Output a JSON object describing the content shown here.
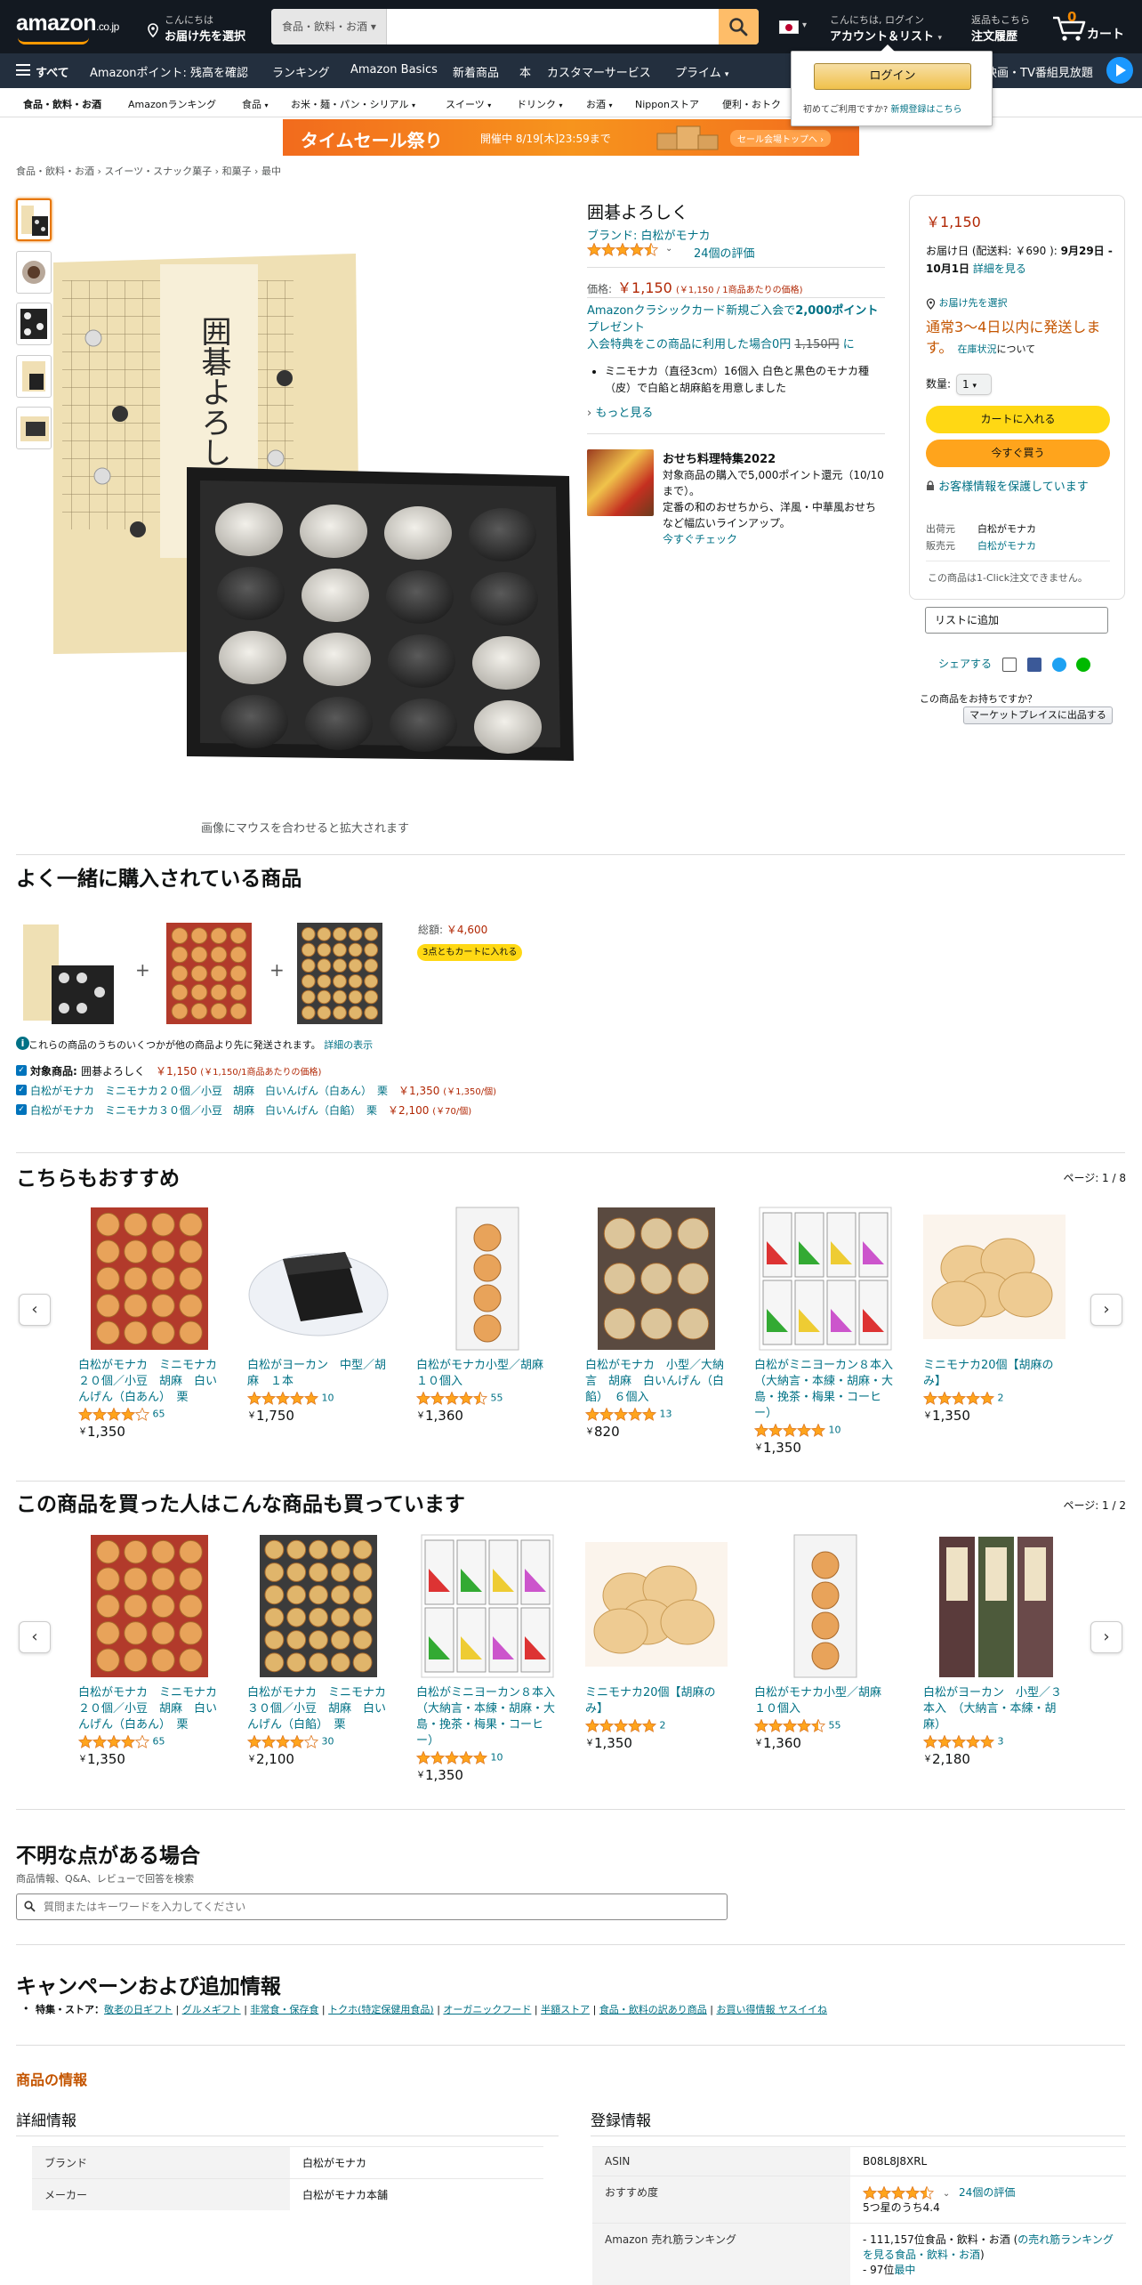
{
  "header": {
    "logo_text": "amazon",
    "logo_tld": ".co.jp",
    "deliver_line1": "こんにちは",
    "deliver_line2": "お届け先を選択",
    "search_category": "食品・飲料・お酒",
    "search_placeholder": "",
    "account_line1": "こんにちは, ログイン",
    "account_line2": "アカウント＆リスト",
    "orders_line1": "返品もこちら",
    "orders_line2": "注文履歴",
    "cart_count": "0",
    "cart_label": "カート"
  },
  "nav_main": {
    "all_label": "すべて",
    "items": [
      "Amazonポイント: 残高を確認",
      "ランキング",
      "Amazon Basics",
      "新着商品",
      "本",
      "カスタマーサービス",
      "プライム"
    ],
    "right_item": "映画・TV番組見放題"
  },
  "subnav": {
    "items": [
      "食品・飲料・お酒",
      "Amazonランキング",
      "食品",
      "お米・麺・パン・シリアル",
      "スイーツ",
      "ドリンク",
      "お酒",
      "Nipponストア",
      "便利・おトク"
    ]
  },
  "signin_flyout": {
    "button": "ログイン",
    "note": "初めてご利用ですか?",
    "note_link": "新規登録はこちら"
  },
  "sale_banner": {
    "title": "タイムセール祭り",
    "subtitle": "開催中 8/19[木]23:59まで",
    "link": "セール会場トップへ ›"
  },
  "breadcrumb": "食品・飲料・お酒 › スイーツ・スナック菓子 › 和菓子 › 最中",
  "product": {
    "box_text": "囲碁よろしく",
    "title": "囲碁よろしく",
    "brand": "ブランド: 白松がモナカ",
    "rating": 4.5,
    "rating_count": "24個の評価",
    "price_label": "価格:",
    "price": "￥1,150",
    "price_unit": "(￥1,150 / 1商品あたりの価格)",
    "card_promo_1": "Amazonクラシックカード新規ご入会で",
    "card_promo_points": "2,000ポイント",
    "card_promo_2": "プレゼント",
    "card_promo_3": "入会特典をこの商品に利用した場合0円",
    "card_promo_strike": "1,150円",
    "card_promo_4": "に",
    "bullet": "ミニモナカ（直径3cm）16個入 白色と黒色のモナカ種（皮）で白餡と胡麻餡を用意しました",
    "more_link": "もっと見る",
    "zoom_hint": "画像にマウスを合わせると拡大されます"
  },
  "osechi": {
    "title": "おせち料理特集2022",
    "line1": "対象商品の購入で5,000ポイント還元（10/10まで）。",
    "line2": "定番の和のおせちから、洋風・中華風おせちなど幅広いラインアップ。",
    "link": "今すぐチェック"
  },
  "buybox": {
    "price": "￥1,150",
    "delivery_1": "お届け日 (配送料: ￥690 ): ",
    "delivery_bold": "9月29日 - 10月1日",
    "delivery_link": "詳細を見る",
    "location": "お届け先を選択",
    "stock": "通常3～4日以内に発送します。",
    "stock_link": "在庫状況",
    "stock_tail": "について",
    "qty_label": "数量:",
    "qty_value": "1",
    "add_to_cart": "カートに入れる",
    "buy_now": "今すぐ買う",
    "secure": "お客様情報を保護しています",
    "ship_from_label": "出荷元",
    "ship_from": "白松がモナカ",
    "sold_by_label": "販売元",
    "sold_by": "白松がモナカ",
    "oneclick": "この商品は1-Click注文できません。",
    "add_to_list": "リストに追加",
    "share": "シェアする",
    "sell_q": "この商品をお持ちですか？",
    "sell_btn": "マーケットプレイスに出品する"
  },
  "fbt": {
    "title": "よく一緒に購入されている商品",
    "total_label": "総額:",
    "total": "￥4,600",
    "button": "3点ともカートに入れる",
    "note": "これらの商品のうちのいくつかが他の商品より先に発送されます。",
    "note_link": "詳細の表示",
    "rows": [
      {
        "prefix": "対象商品: ",
        "name": "囲碁よろしく",
        "price": "￥1,150",
        "unit": "(￥1,150/1商品あたりの価格)"
      },
      {
        "prefix": "",
        "name": "白松がモナカ　ミニモナカ２０個／小豆　胡麻　白いんげん（白あん）　栗",
        "price": "￥1,350",
        "unit": "(￥1,350/個)"
      },
      {
        "prefix": "",
        "name": "白松がモナカ　ミニモナカ３０個／小豆　胡麻　白いんげん（白餡）　栗",
        "price": "￥2,100",
        "unit": "(￥70/個)"
      }
    ]
  },
  "recommend": {
    "title": "こちらもおすすめ",
    "pager": "ページ: 1 / 8",
    "items": [
      {
        "name": "白松がモナカ　ミニモナカ２０個／小豆　胡麻　白いんげん（白あん）　栗",
        "rating": 4.0,
        "count": "65",
        "price": "1,350"
      },
      {
        "name": "白松がヨーカン　中型／胡麻　１本",
        "rating": 5.0,
        "count": "10",
        "price": "1,750"
      },
      {
        "name": "白松がモナカ小型／胡麻　１０個入",
        "rating": 4.5,
        "count": "55",
        "price": "1,360"
      },
      {
        "name": "白松がモナカ　小型／大納言　胡麻　白いんげん（白餡）　６個入",
        "rating": 5.0,
        "count": "13",
        "price": "820"
      },
      {
        "name": "白松がミニヨーカン８本入　（大納言・本練・胡麻・大島・挽茶・梅果・コーヒー）",
        "rating": 5.0,
        "count": "10",
        "price": "1,350"
      },
      {
        "name": "ミニモナカ20個【胡麻のみ】",
        "rating": 5.0,
        "count": "2",
        "price": "1,350"
      }
    ]
  },
  "also_bought": {
    "title": "この商品を買った人はこんな商品も買っています",
    "pager": "ページ: 1 / 2",
    "items": [
      {
        "name": "白松がモナカ　ミニモナカ２０個／小豆　胡麻　白いんげん（白あん）　栗",
        "rating": 4.0,
        "count": "65",
        "price": "1,350"
      },
      {
        "name": "白松がモナカ　ミニモナカ３０個／小豆　胡麻　白いんげん（白餡）　栗",
        "rating": 4.0,
        "count": "30",
        "price": "2,100"
      },
      {
        "name": "白松がミニヨーカン８本入　（大納言・本練・胡麻・大島・挽茶・梅果・コーヒー）",
        "rating": 5.0,
        "count": "10",
        "price": "1,350"
      },
      {
        "name": "ミニモナカ20個【胡麻のみ】",
        "rating": 5.0,
        "count": "2",
        "price": "1,350"
      },
      {
        "name": "白松がモナカ小型／胡麻　１０個入",
        "rating": 4.5,
        "count": "55",
        "price": "1,360"
      },
      {
        "name": "白松がヨーカン　小型／３本入　（大納言・本練・胡麻）",
        "rating": 5.0,
        "count": "3",
        "price": "2,180"
      }
    ]
  },
  "qa": {
    "title": "不明な点がある場合",
    "sub": "商品情報、Q&A、レビューで回答を検索",
    "placeholder": "質問またはキーワードを入力してください"
  },
  "campaign": {
    "title": "キャンペーンおよび追加情報",
    "label": "特集・ストア：",
    "links": [
      "敬老の日ギフト",
      "グルメギフト",
      "非常食・保存食",
      "トクホ(特定保健用食品)",
      "オーガニックフード",
      "半額ストア",
      "食品・飲料の訳あり商品",
      "お買い得情報 ヤスイイね"
    ]
  },
  "product_info": {
    "title": "商品の情報",
    "detail_title": "詳細情報",
    "register_title": "登録情報",
    "detail_rows": [
      {
        "k": "ブランド",
        "v": "白松がモナカ"
      },
      {
        "k": "メーカー",
        "v": "白松がモナカ本舗"
      }
    ],
    "asin_label": "ASIN",
    "asin": "B08L8J8XRL",
    "reco_label": "おすすめ度",
    "reco_count": "24個の評価",
    "reco_score": "5つ星のうち4.4",
    "rank_label": "Amazon 売れ筋ランキング",
    "rank_1": "- 111,157位食品・飲料・お酒 (",
    "rank_1_link": "の売れ筋ランキングを見る食品・飲料・お酒",
    "rank_1_tail": ")",
    "rank_2": "- 97位",
    "rank_2_link": "最中"
  }
}
